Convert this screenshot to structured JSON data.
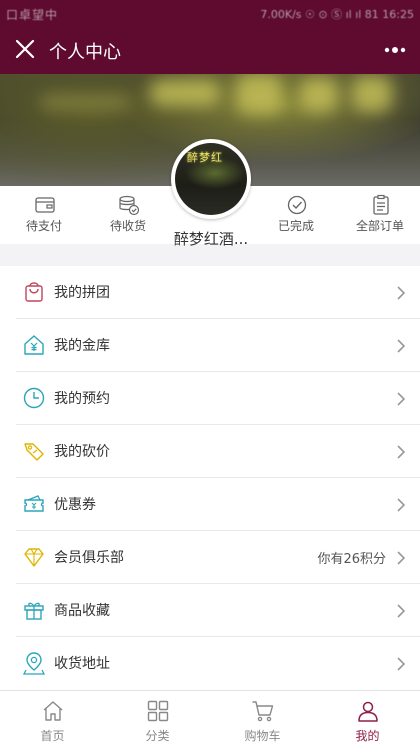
{
  "status_bar": {
    "left": "口卓望中",
    "right": "7.00K/s ☉ ⊙ Ⓢ ıl ıl 81 16:25"
  },
  "nav": {
    "title": "个人中心"
  },
  "profile": {
    "nickname": "醉梦红酒...",
    "avatar_sign": "醉梦红"
  },
  "orders": [
    {
      "label": "待支付",
      "icon": "wallet-icon"
    },
    {
      "label": "待收货",
      "icon": "coins-check-icon"
    },
    {
      "label": "已完成",
      "icon": "check-circle-icon"
    },
    {
      "label": "全部订单",
      "icon": "clipboard-icon"
    }
  ],
  "menu": [
    {
      "label": "我的拼团",
      "icon": "shopping-bag-icon",
      "extra": ""
    },
    {
      "label": "我的金库",
      "icon": "yuan-house-icon",
      "extra": ""
    },
    {
      "label": "我的预约",
      "icon": "clock-icon",
      "extra": ""
    },
    {
      "label": "我的砍价",
      "icon": "price-tag-icon",
      "extra": ""
    },
    {
      "label": "优惠券",
      "icon": "coupon-icon",
      "extra": ""
    },
    {
      "label": "会员俱乐部",
      "icon": "diamond-icon",
      "extra": "你有26积分"
    },
    {
      "label": "商品收藏",
      "icon": "gift-icon",
      "extra": ""
    },
    {
      "label": "收货地址",
      "icon": "location-pin-icon",
      "extra": ""
    }
  ],
  "tabs": [
    {
      "label": "首页",
      "icon": "home-icon",
      "active": false
    },
    {
      "label": "分类",
      "icon": "grid-icon",
      "active": false
    },
    {
      "label": "购物车",
      "icon": "cart-icon",
      "active": false
    },
    {
      "label": "我的",
      "icon": "person-icon",
      "active": true
    }
  ],
  "colors": {
    "primary": "#5e0b2f",
    "active_tab": "#8f1f4a",
    "icon_red": "#c0455e",
    "icon_teal": "#2aa6b8",
    "icon_gold": "#e0b400",
    "divider": "#e8e8ea"
  }
}
